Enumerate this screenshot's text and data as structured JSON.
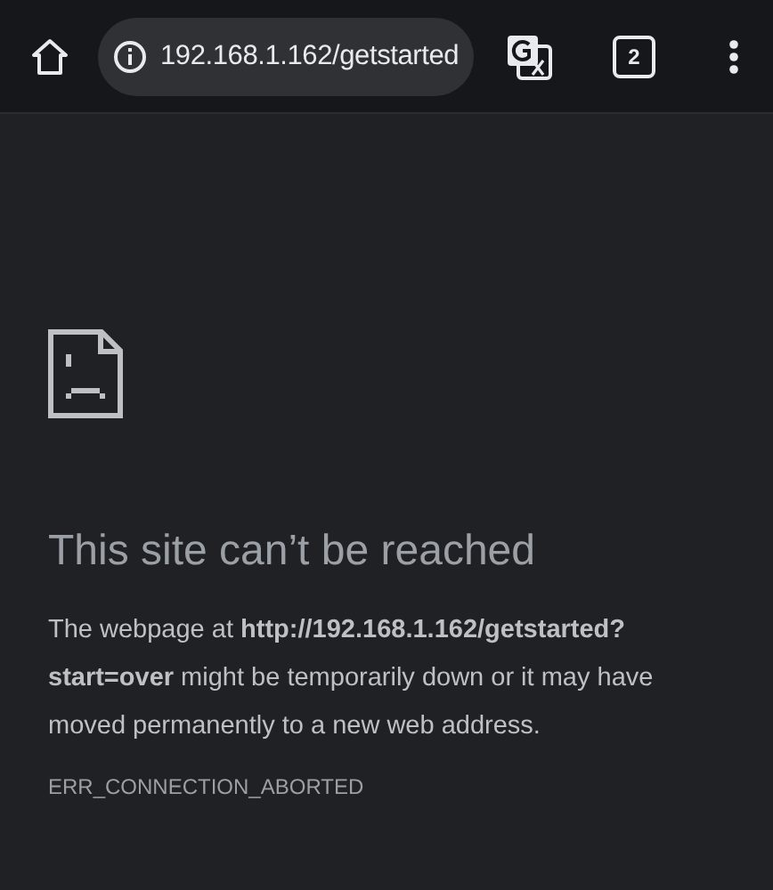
{
  "toolbar": {
    "url": "192.168.1.162/getstarted",
    "tab_count": "2"
  },
  "error": {
    "title": "This site can’t be reached",
    "message": "The webpage at **http://192.168.1.162/getstarted?start=over** might be temporarily down or it may have moved permanently to a new web address.",
    "code": "ERR_CONNECTION_ABORTED"
  }
}
